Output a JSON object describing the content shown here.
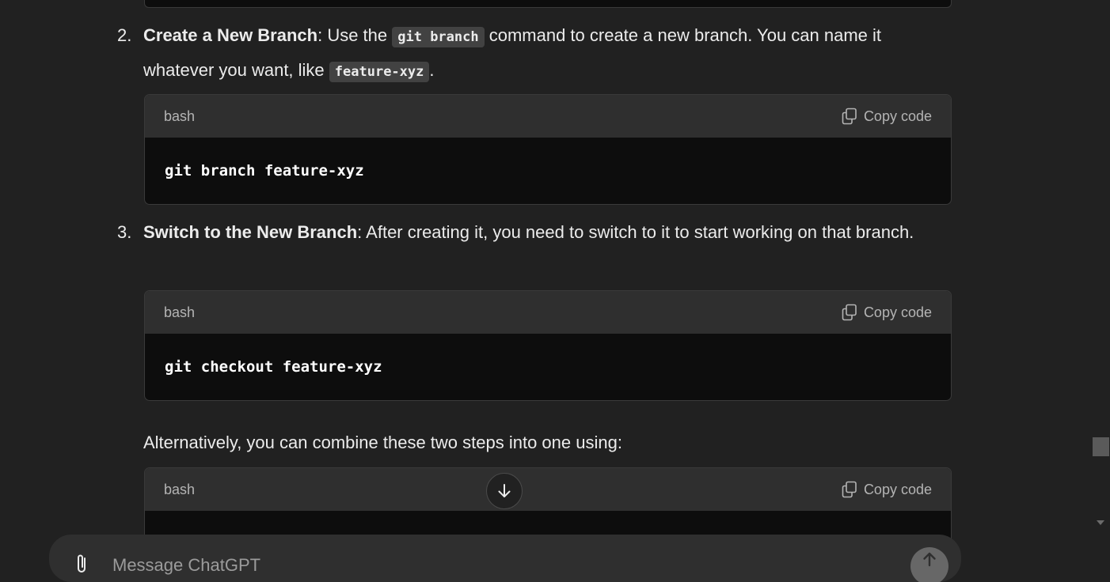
{
  "steps": [
    {
      "number": "2.",
      "title": "Create a New Branch",
      "text_before_code1": ": Use the ",
      "code1": "git branch",
      "text_after_code1": " command to create a new branch. You can name it whatever you want, like ",
      "code2": "feature-xyz",
      "text_end": ".",
      "block": {
        "language": "bash",
        "copy_label": "Copy code",
        "code": "git branch feature-xyz"
      }
    },
    {
      "number": "3.",
      "title": "Switch to the New Branch",
      "text": ": After creating it, you need to switch to it to start working on that branch.",
      "block": {
        "language": "bash",
        "copy_label": "Copy code",
        "code": "git checkout feature-xyz"
      }
    }
  ],
  "alternative": {
    "text": "Alternatively, you can combine these two steps into one using:",
    "block": {
      "language": "bash",
      "copy_label": "Copy code"
    }
  },
  "composer": {
    "placeholder": "Message ChatGPT"
  },
  "icons": {
    "copy": "copy-icon",
    "scroll_down": "arrow-down-icon",
    "attach": "paperclip-icon",
    "send": "arrow-up-icon"
  }
}
